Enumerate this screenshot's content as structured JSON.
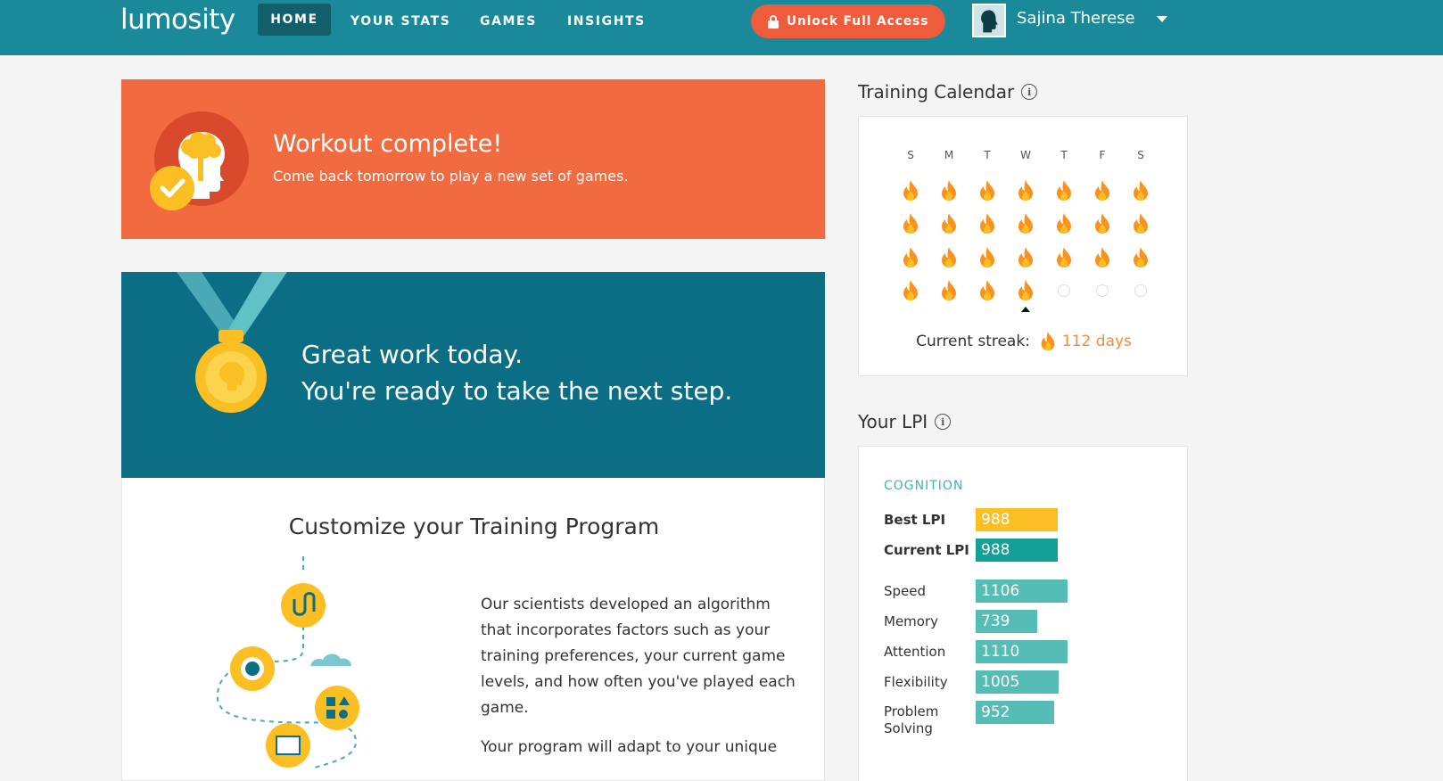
{
  "nav": {
    "logo": "lumosity",
    "items": [
      "HOME",
      "YOUR STATS",
      "GAMES",
      "INSIGHTS"
    ],
    "unlock_label": "Unlock Full Access",
    "user_name": "Sajina Therese"
  },
  "workout": {
    "title": "Workout complete!",
    "subtitle": "Come back tomorrow to play a new set of games."
  },
  "next_step": {
    "line1": "Great work today.",
    "line2": "You're ready to take the next step."
  },
  "customize": {
    "title": "Customize your Training Program",
    "paragraph1": "Our scientists developed an algorithm that incorporates factors such as your training preferences, your current game levels, and how often you've played each game.",
    "paragraph2": "Your program will adapt to your unique"
  },
  "calendar": {
    "heading": "Training Calendar",
    "days": [
      "S",
      "M",
      "T",
      "W",
      "T",
      "F",
      "S"
    ],
    "weeks": [
      [
        1,
        1,
        1,
        1,
        1,
        1,
        1
      ],
      [
        1,
        1,
        1,
        1,
        1,
        1,
        1
      ],
      [
        1,
        1,
        1,
        1,
        1,
        1,
        1
      ],
      [
        1,
        1,
        1,
        1,
        0,
        0,
        0
      ]
    ],
    "today_col": 3,
    "streak_label": "Current streak:",
    "streak_value": "112 days"
  },
  "lpi": {
    "heading": "Your LPI",
    "section": "COGNITION",
    "best_label": "Best LPI",
    "best_value": 988,
    "current_label": "Current LPI",
    "current_value": 988,
    "areas": [
      {
        "label": "Speed",
        "value": 1106
      },
      {
        "label": "Memory",
        "value": 739
      },
      {
        "label": "Attention",
        "value": 1110
      },
      {
        "label": "Flexibility",
        "value": 1005
      },
      {
        "label": "Problem Solving",
        "value": 952
      }
    ]
  },
  "colors": {
    "header": "#1a8a9b",
    "workout_bg": "#f26b40",
    "next_bg": "#0b6e85",
    "best_bar": "#fbbf24",
    "current_bar": "#13a096",
    "area_bar": "#55bcb6",
    "flame": "#f7931e"
  }
}
